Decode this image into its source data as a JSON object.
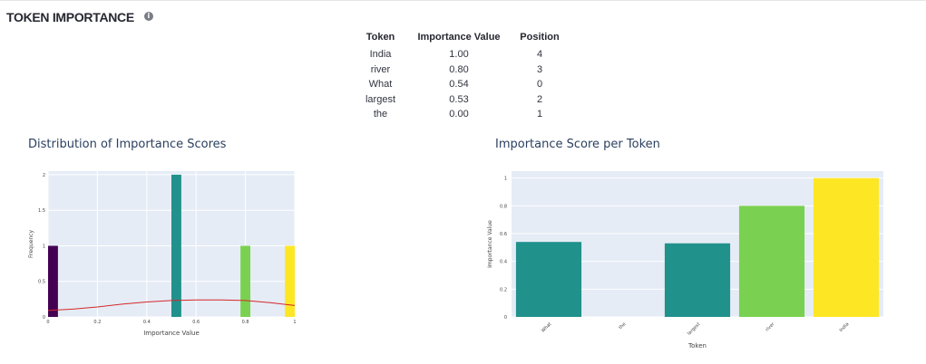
{
  "header": {
    "title": "TOKEN IMPORTANCE",
    "info_icon": "info-icon"
  },
  "table": {
    "columns": [
      "Token",
      "Importance Value",
      "Position"
    ],
    "rows": [
      [
        "India",
        "1.00",
        "4"
      ],
      [
        "river",
        "0.80",
        "3"
      ],
      [
        "What",
        "0.54",
        "0"
      ],
      [
        "largest",
        "0.53",
        "2"
      ],
      [
        "the",
        "0.00",
        "1"
      ]
    ]
  },
  "chart_data": [
    {
      "type": "bar",
      "subtype": "histogram",
      "title": "Distribution of Importance Scores",
      "xlabel": "Importance Value",
      "ylabel": "Frequency",
      "xlim": [
        0,
        1
      ],
      "ylim": [
        0,
        2.05
      ],
      "xticks": [
        "0",
        "0.2",
        "0.4",
        "0.6",
        "0.8",
        "1"
      ],
      "yticks": [
        "0",
        "0.5",
        "1",
        "1.5",
        "2"
      ],
      "bins": [
        {
          "x0": 0.0,
          "x1": 0.04,
          "count": 1,
          "color": "#440154"
        },
        {
          "x0": 0.5,
          "x1": 0.54,
          "count": 2,
          "color": "#21918c"
        },
        {
          "x0": 0.78,
          "x1": 0.82,
          "count": 1,
          "color": "#7ad151"
        },
        {
          "x0": 0.96,
          "x1": 1.0,
          "count": 1,
          "color": "#fde725"
        }
      ],
      "kde": {
        "color": "#d62728",
        "x": [
          0,
          0.1,
          0.2,
          0.3,
          0.4,
          0.5,
          0.6,
          0.7,
          0.8,
          0.9,
          1.0
        ],
        "y": [
          0.09,
          0.11,
          0.14,
          0.18,
          0.21,
          0.23,
          0.24,
          0.24,
          0.23,
          0.2,
          0.16
        ]
      },
      "grid": true
    },
    {
      "type": "bar",
      "title": "Importance Score per Token",
      "xlabel": "Token",
      "ylabel": "Importance Value",
      "ylim": [
        0,
        1.05
      ],
      "yticks": [
        "0",
        "0.2",
        "0.4",
        "0.6",
        "0.8",
        "1"
      ],
      "categories": [
        "What",
        "the",
        "largest",
        "river",
        "India"
      ],
      "values": [
        0.54,
        0.0,
        0.53,
        0.8,
        1.0
      ],
      "colors": [
        "#21918c",
        "#440154",
        "#21918c",
        "#7ad151",
        "#fde725"
      ],
      "grid": true
    }
  ]
}
